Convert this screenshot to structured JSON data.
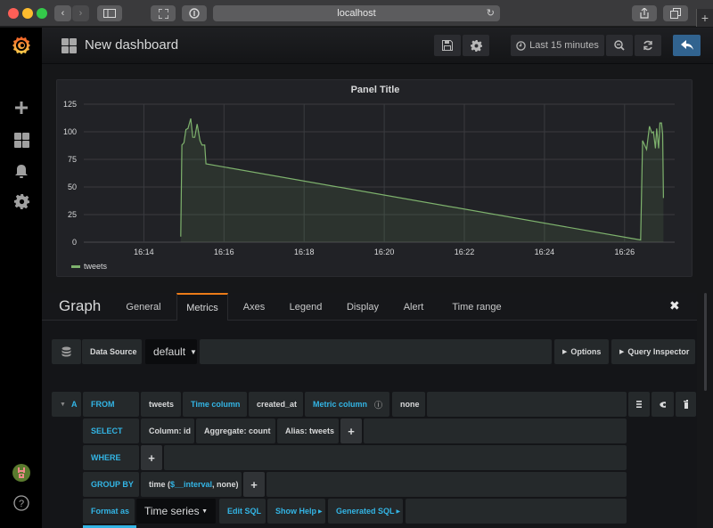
{
  "browser": {
    "url": "localhost",
    "traffic_colors": {
      "close": "#fc5f57",
      "minimize": "#fdbc2e",
      "maximize": "#34c84a"
    }
  },
  "sidebar": {
    "logo": "grafana-logo-icon",
    "items": [
      {
        "name": "create",
        "icon": "plus-icon"
      },
      {
        "name": "dashboards",
        "icon": "grid-icon"
      },
      {
        "name": "alerting",
        "icon": "bell-icon"
      },
      {
        "name": "configuration",
        "icon": "gear-icon"
      }
    ],
    "bottom": [
      {
        "name": "profile",
        "icon": "avatar-icon"
      },
      {
        "name": "help",
        "icon": "help-icon",
        "glyph": "?"
      }
    ]
  },
  "navbar": {
    "title": "New dashboard",
    "time_range": "Last 15 minutes",
    "accent": "#31638f"
  },
  "panel": {
    "title": "Panel Title",
    "legend": [
      {
        "name": "tweets",
        "color": "#7eb26d"
      }
    ]
  },
  "chart_data": {
    "type": "area",
    "title": "Panel Title",
    "xlabel": "",
    "ylabel": "",
    "x_ticks": [
      "16:14",
      "16:16",
      "16:18",
      "16:20",
      "16:22",
      "16:24",
      "16:26"
    ],
    "y_ticks": [
      0,
      25,
      50,
      75,
      100,
      125
    ],
    "ylim": [
      0,
      125
    ],
    "xlim_minutes": [
      12.5,
      27.25
    ],
    "grid": true,
    "legend_position": "bottom-left",
    "series": [
      {
        "name": "tweets",
        "color": "#7eb26d",
        "points_minutes_after_16h": [
          [
            14.92,
            5
          ],
          [
            14.95,
            88
          ],
          [
            15.0,
            90
          ],
          [
            15.05,
            102
          ],
          [
            15.1,
            103
          ],
          [
            15.17,
            112
          ],
          [
            15.22,
            95
          ],
          [
            15.27,
            95
          ],
          [
            15.33,
            107
          ],
          [
            15.4,
            92
          ],
          [
            15.45,
            88
          ],
          [
            15.52,
            88
          ],
          [
            15.55,
            71
          ],
          [
            26.4,
            2
          ],
          [
            26.45,
            92
          ],
          [
            26.55,
            84
          ],
          [
            26.62,
            105
          ],
          [
            26.68,
            99
          ],
          [
            26.72,
            100
          ],
          [
            26.77,
            85
          ],
          [
            26.8,
            103
          ],
          [
            26.85,
            85
          ],
          [
            26.88,
            108
          ],
          [
            26.92,
            108
          ],
          [
            26.95,
            98
          ],
          [
            26.97,
            40
          ]
        ]
      }
    ]
  },
  "editor": {
    "title": "Graph",
    "tabs": [
      "General",
      "Metrics",
      "Axes",
      "Legend",
      "Display",
      "Alert",
      "Time range"
    ],
    "active_tab": "Metrics",
    "datasource_label": "Data Source",
    "datasource_value": "default",
    "options_label": "Options",
    "query_inspector_label": "Query Inspector",
    "query": {
      "ref": "A",
      "from_label": "FROM",
      "table": "tweets",
      "time_column_label": "Time column",
      "time_column": "created_at",
      "metric_column_label": "Metric column",
      "metric_column": "none",
      "select_label": "SELECT",
      "select_items": [
        "Column: id",
        "Aggregate: count",
        "Alias: tweets"
      ],
      "where_label": "WHERE",
      "group_by_label": "GROUP BY",
      "group_by_prefix": "time (",
      "group_by_var": "$__interval",
      "group_by_suffix": ", none)",
      "format_as_label": "Format as",
      "format_as_value": "Time series",
      "edit_sql_label": "Edit SQL",
      "show_help_label": "Show Help",
      "generated_sql_label": "Generated SQL",
      "plus": "+"
    }
  }
}
